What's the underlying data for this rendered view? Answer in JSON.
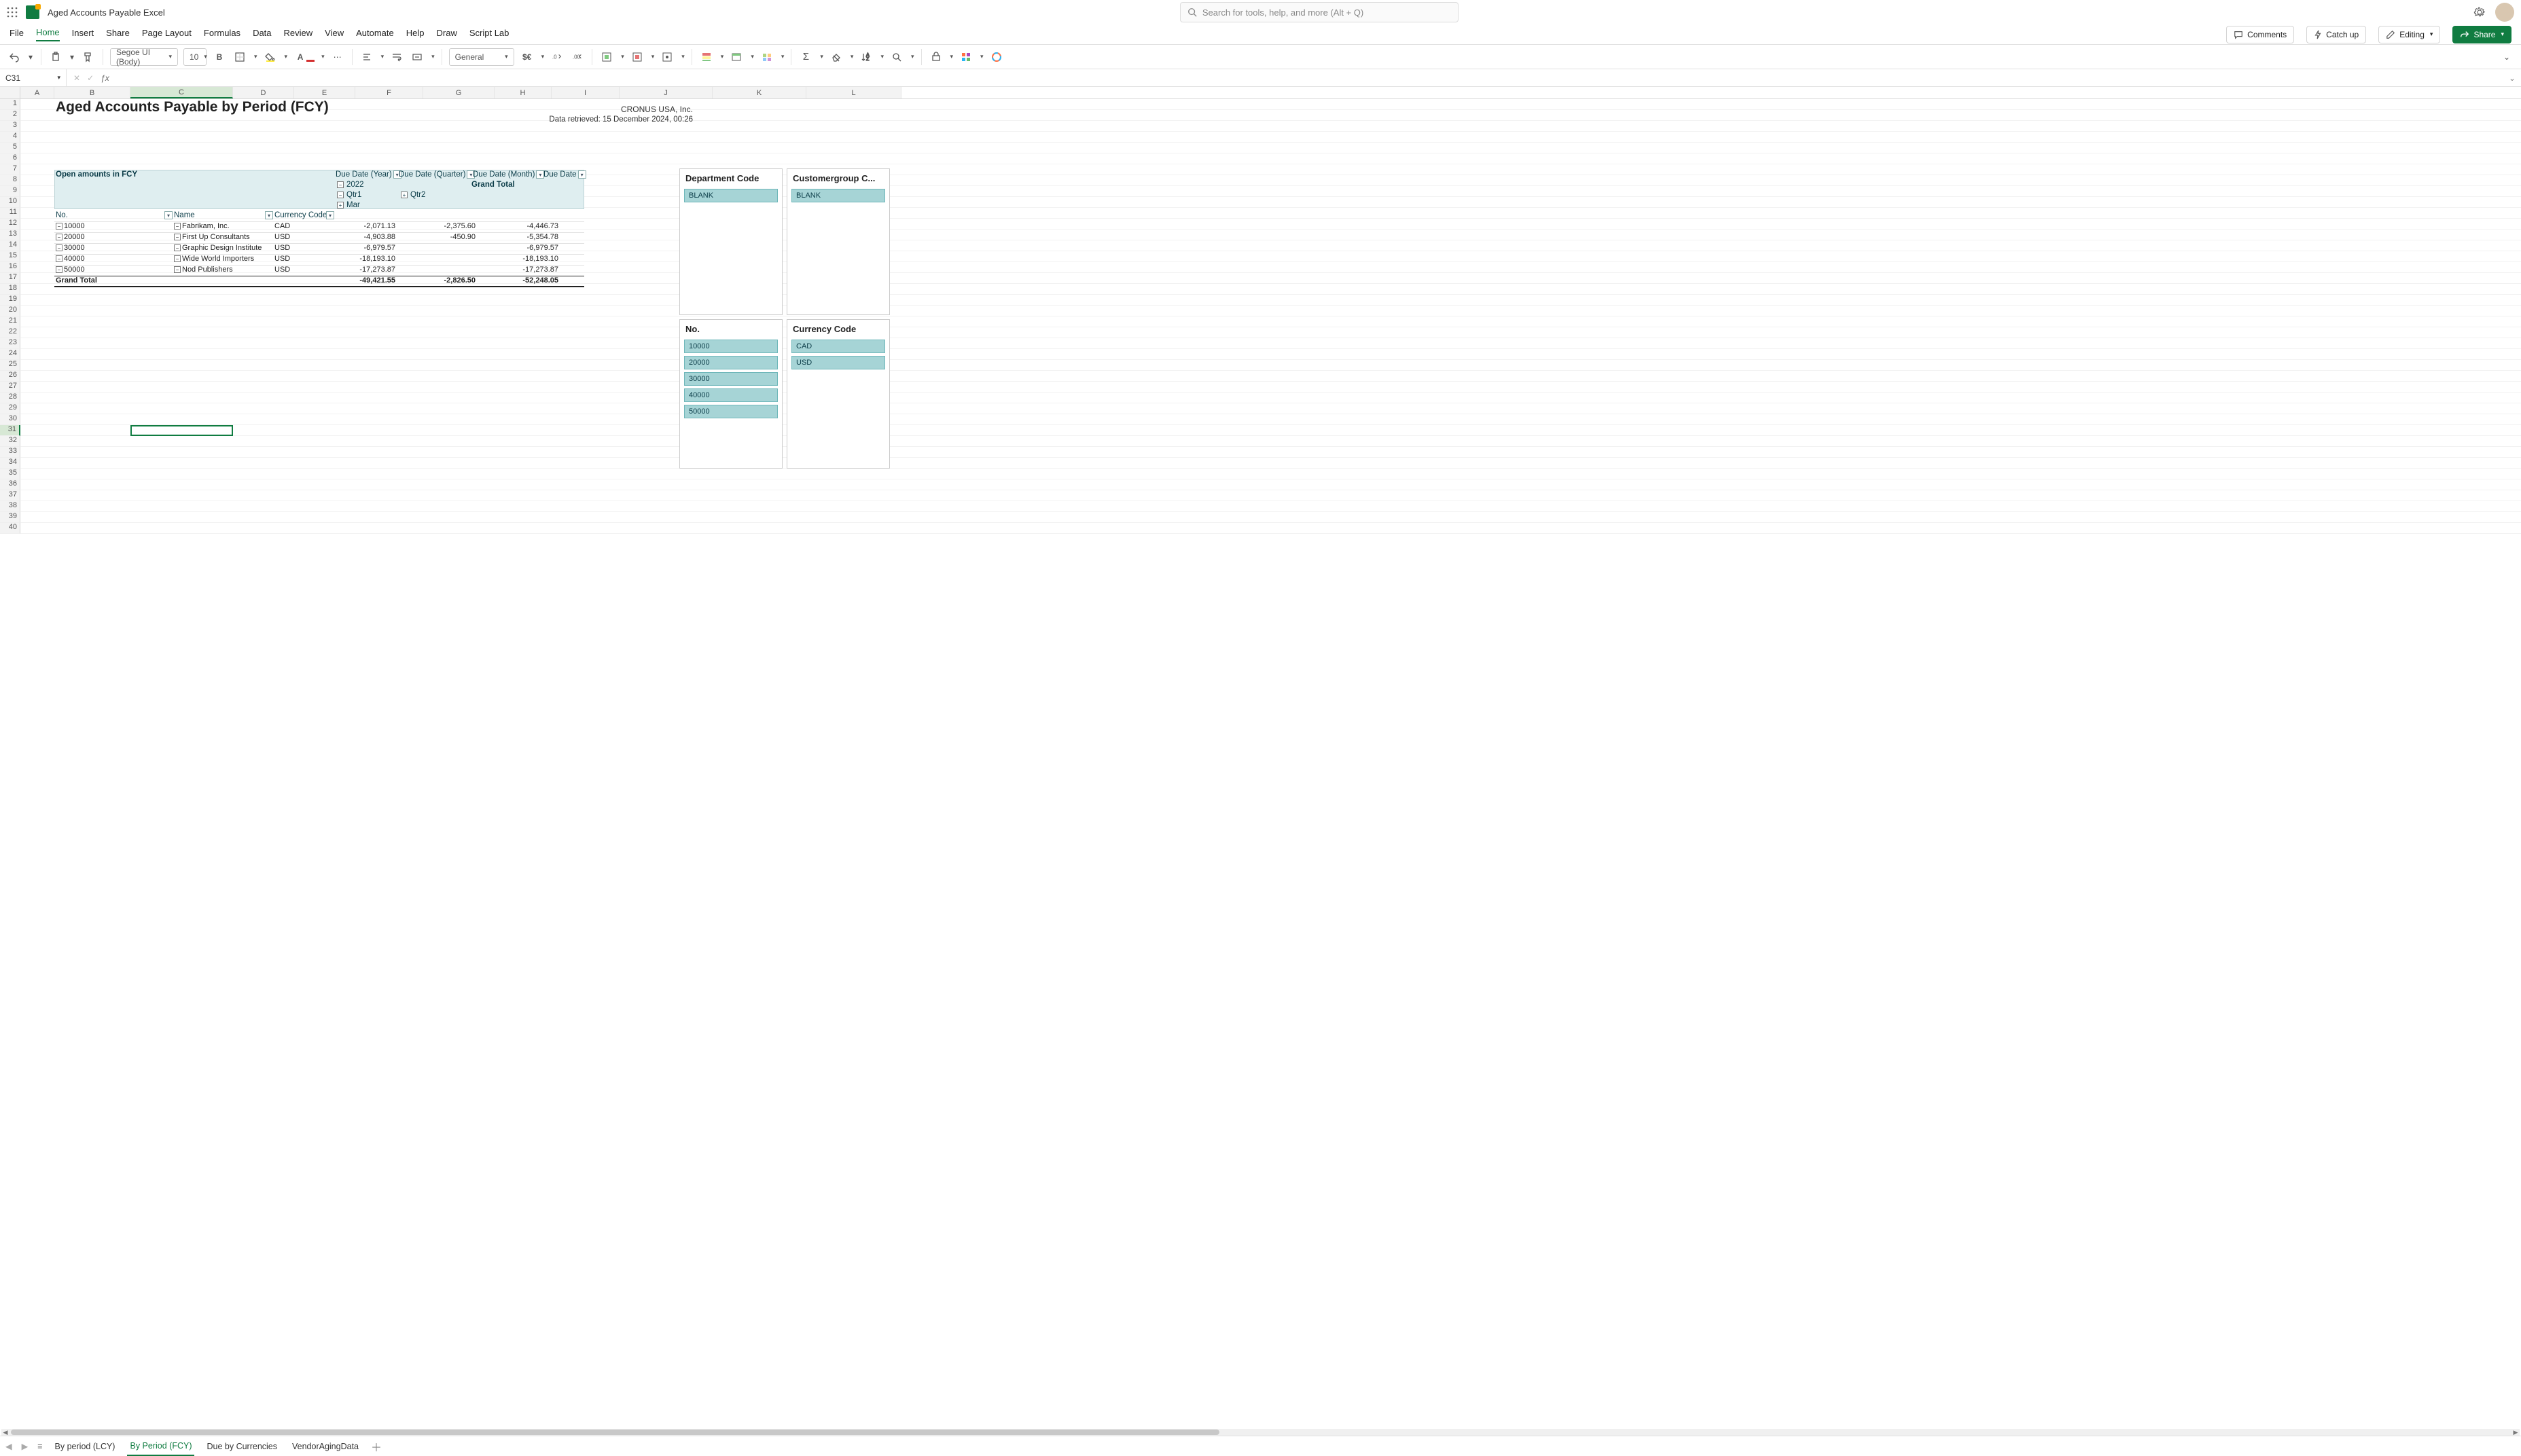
{
  "app": {
    "doc_title": "Aged Accounts Payable Excel",
    "search_placeholder": "Search for tools, help, and more (Alt + Q)"
  },
  "menubar": {
    "tabs": [
      "File",
      "Home",
      "Insert",
      "Share",
      "Page Layout",
      "Formulas",
      "Data",
      "Review",
      "View",
      "Automate",
      "Help",
      "Draw",
      "Script Lab"
    ],
    "active_index": 1,
    "comments": "Comments",
    "catchup": "Catch up",
    "editing": "Editing",
    "share": "Share"
  },
  "ribbon": {
    "font_name": "Segoe UI (Body)",
    "font_size": "10",
    "num_format": "General"
  },
  "formula_bar": {
    "name_box": "C31",
    "formula": ""
  },
  "columns": [
    "A",
    "B",
    "C",
    "D",
    "E",
    "F",
    "G",
    "H",
    "I",
    "J",
    "K",
    "L"
  ],
  "selected_col_index": 2,
  "row_count": 40,
  "selected_row": 31,
  "report": {
    "title": "Aged Accounts Payable by Period (FCY)",
    "company": "CRONUS USA, Inc.",
    "retrieved": "Data retrieved: 15 December 2024, 00:26",
    "pivot": {
      "open_amounts_label": "Open amounts in FCY",
      "year_label": "Due Date (Year)",
      "quarter_label": "Due Date (Quarter)",
      "month_label": "Due Date (Month)",
      "duedate_label": "Due Date",
      "grand_total_label": "Grand Total",
      "year_value": "2022",
      "q1": "Qtr1",
      "q2": "Qtr2",
      "mar": "Mar",
      "no_label": "No.",
      "name_label": "Name",
      "currency_label": "Currency Code",
      "rows": [
        {
          "no": "10000",
          "name": "Fabrikam, Inc.",
          "curr": "CAD",
          "v1": "-2,071.13",
          "v2": "-2,375.60",
          "gt": "-4,446.73"
        },
        {
          "no": "20000",
          "name": "First Up Consultants",
          "curr": "USD",
          "v1": "-4,903.88",
          "v2": "-450.90",
          "gt": "-5,354.78"
        },
        {
          "no": "30000",
          "name": "Graphic Design Institute",
          "curr": "USD",
          "v1": "-6,979.57",
          "v2": "",
          "gt": "-6,979.57"
        },
        {
          "no": "40000",
          "name": "Wide World Importers",
          "curr": "USD",
          "v1": "-18,193.10",
          "v2": "",
          "gt": "-18,193.10"
        },
        {
          "no": "50000",
          "name": "Nod Publishers",
          "curr": "USD",
          "v1": "-17,273.87",
          "v2": "",
          "gt": "-17,273.87"
        }
      ],
      "grand_total_row": {
        "label": "Grand Total",
        "v1": "-49,421.55",
        "v2": "-2,826.50",
        "gt": "-52,248.05"
      }
    }
  },
  "slicers": {
    "department": {
      "title": "Department Code",
      "items": [
        "BLANK"
      ]
    },
    "customergroup": {
      "title": "Customergroup C...",
      "items": [
        "BLANK"
      ]
    },
    "no": {
      "title": "No.",
      "items": [
        "10000",
        "20000",
        "30000",
        "40000",
        "50000"
      ]
    },
    "currency": {
      "title": "Currency Code",
      "items": [
        "CAD",
        "USD"
      ]
    }
  },
  "sheet_tabs": {
    "tabs": [
      "By period (LCY)",
      "By Period (FCY)",
      "Due by Currencies",
      "VendorAgingData"
    ],
    "active_index": 1
  },
  "chart_data": {
    "type": "table",
    "title": "Aged Accounts Payable by Period (FCY)",
    "columns": [
      "No.",
      "Name",
      "Currency Code",
      "2022 Qtr1 Mar",
      "2022 Qtr2",
      "Grand Total"
    ],
    "rows": [
      [
        "10000",
        "Fabrikam, Inc.",
        "CAD",
        -2071.13,
        -2375.6,
        -4446.73
      ],
      [
        "20000",
        "First Up Consultants",
        "USD",
        -4903.88,
        -450.9,
        -5354.78
      ],
      [
        "30000",
        "Graphic Design Institute",
        "USD",
        -6979.57,
        null,
        -6979.57
      ],
      [
        "40000",
        "Wide World Importers",
        "USD",
        -18193.1,
        null,
        -18193.1
      ],
      [
        "50000",
        "Nod Publishers",
        "USD",
        -17273.87,
        null,
        -17273.87
      ]
    ],
    "totals": [
      "Grand Total",
      "",
      "",
      -49421.55,
      -2826.5,
      -52248.05
    ]
  }
}
